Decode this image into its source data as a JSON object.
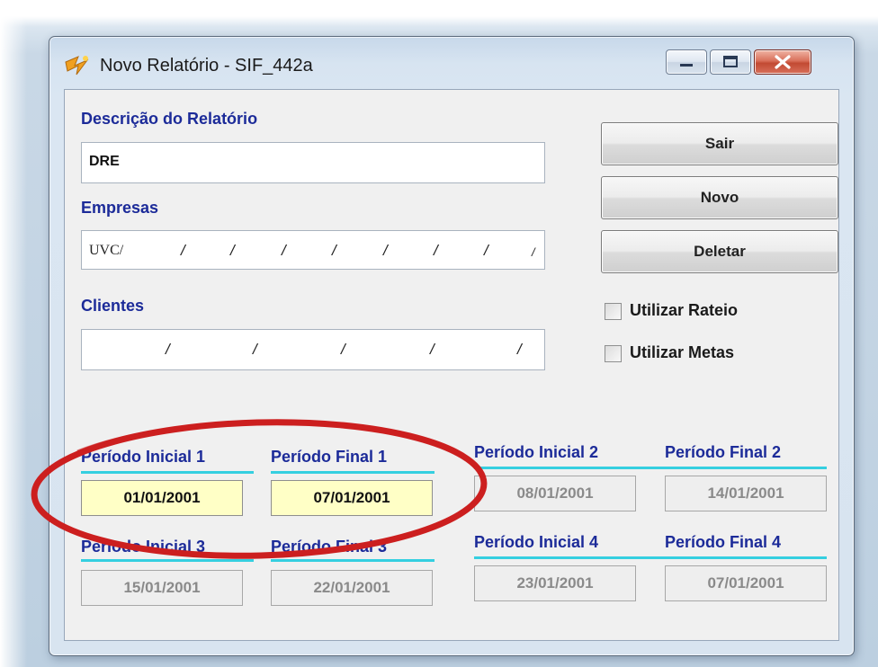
{
  "window": {
    "title": "Novo Relatório - SIF_442a"
  },
  "form": {
    "descricao_label": "Descrição do Relatório",
    "descricao_value": "DRE",
    "empresas_label": "Empresas",
    "empresas_value": "UVC/",
    "clientes_label": "Clientes"
  },
  "buttons": {
    "sair": "Sair",
    "novo": "Novo",
    "deletar": "Deletar"
  },
  "checkboxes": {
    "rateio_label": "Utilizar Rateio",
    "rateio_checked": false,
    "metas_label": "Utilizar Metas",
    "metas_checked": false
  },
  "periods": [
    {
      "label": "Período Inicial 1",
      "value": "01/01/2001",
      "enabled": true
    },
    {
      "label": "Período Final 1",
      "value": "07/01/2001",
      "enabled": true
    },
    {
      "label": "Período Inicial 2",
      "value": "08/01/2001",
      "enabled": false
    },
    {
      "label": "Período Final 2",
      "value": "14/01/2001",
      "enabled": false
    },
    {
      "label": "Período Inicial 3",
      "value": "15/01/2001",
      "enabled": false
    },
    {
      "label": "Período Final 3",
      "value": "22/01/2001",
      "enabled": false
    },
    {
      "label": "Período Inicial 4",
      "value": "23/01/2001",
      "enabled": false
    },
    {
      "label": "Período Final 4",
      "value": "07/01/2001",
      "enabled": false
    }
  ],
  "colors": {
    "label_blue": "#1c2b99",
    "underline_cyan": "#35cfe0",
    "active_field": "#ffffc6",
    "annotation_red": "#cc1f1f"
  }
}
